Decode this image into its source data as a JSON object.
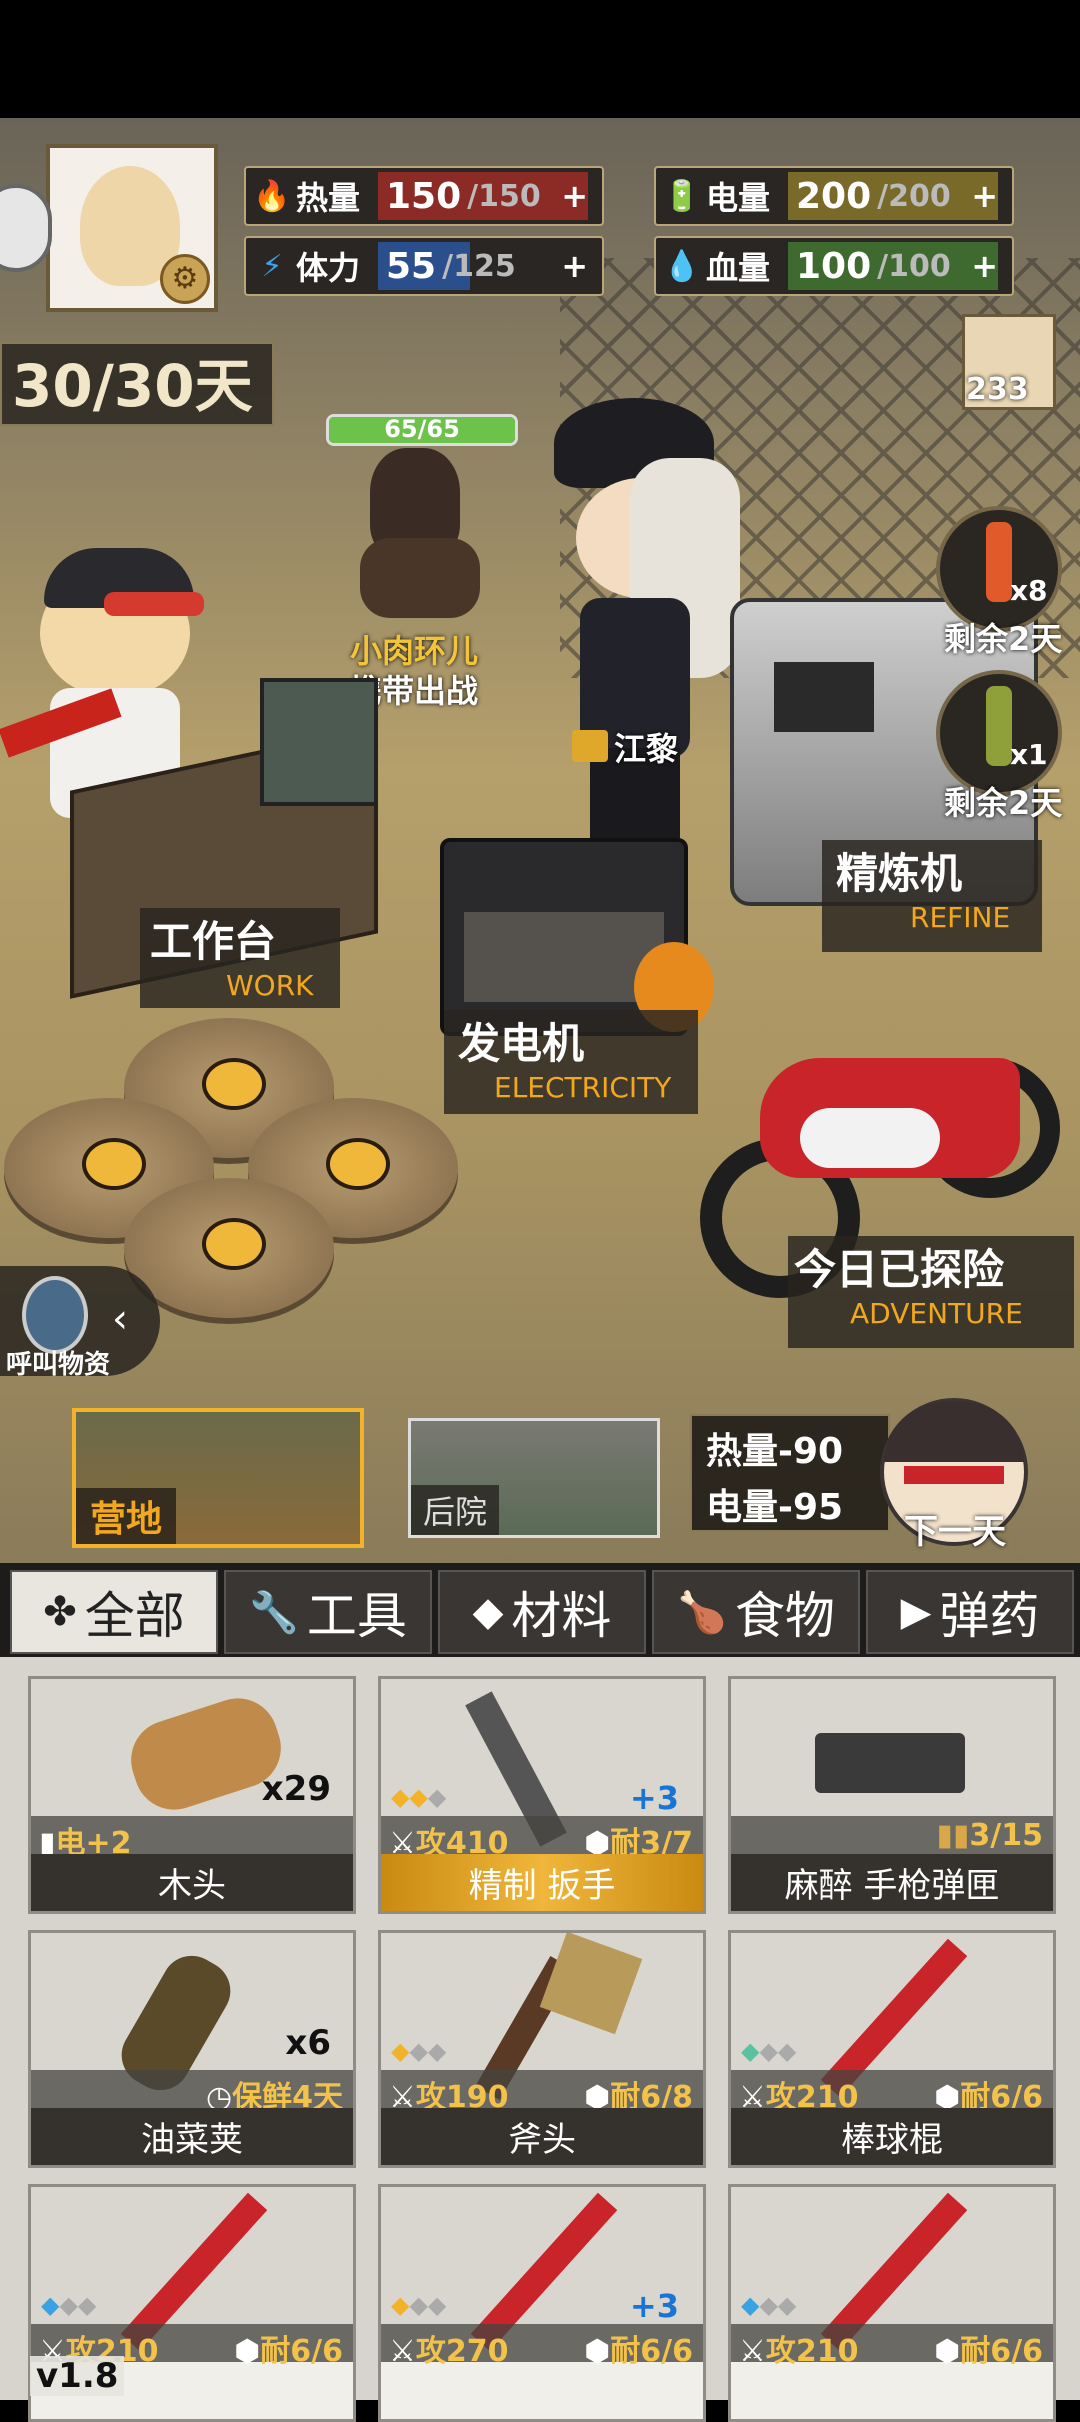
{
  "stats": {
    "heat": {
      "label": "热量",
      "value": "150",
      "max": "/150",
      "plus": "+",
      "color": "#8c2a25",
      "fill": 1.0
    },
    "energy": {
      "label": "体力",
      "value": "55",
      "max": "/125",
      "plus": "+",
      "color": "#2b4f8c",
      "fill": 0.44
    },
    "power": {
      "label": "电量",
      "value": "200",
      "max": "/200",
      "plus": "+",
      "color": "#7a6a2a",
      "fill": 1.0
    },
    "blood": {
      "label": "血量",
      "value": "100",
      "max": "/100",
      "plus": "+",
      "color": "#3f6a2f",
      "fill": 1.0
    }
  },
  "days": "30/30天",
  "paper_count": "233",
  "dog": {
    "hp": "65/65",
    "name": "小肉环儿",
    "action": "携带出战"
  },
  "officer_name": "江黎",
  "potions": [
    {
      "count": "x8",
      "remaining": "剩余2天"
    },
    {
      "count": "x1",
      "remaining": "剩余2天"
    }
  ],
  "stations": {
    "workbench": {
      "cn": "工作台",
      "en": "WORK"
    },
    "generator": {
      "cn": "发电机",
      "en": "ELECTRICITY"
    },
    "refinery": {
      "cn": "精炼机",
      "en": "REFINE"
    },
    "adventure": {
      "cn": "今日已探险",
      "en": "ADVENTURE"
    }
  },
  "call_supplies": "呼叫物资",
  "locations": {
    "camp": "营地",
    "backyard": "后院"
  },
  "next_day": {
    "heat": "热量-90",
    "power": "电量-95",
    "label": "下一天"
  },
  "tabs": [
    "全部",
    "工具",
    "材料",
    "食物",
    "弹药"
  ],
  "items": [
    {
      "name": "木头",
      "count": "x29",
      "stat_left": "电+2"
    },
    {
      "name": "精制 扳手",
      "upgrade": "+3",
      "attack": "攻410",
      "durability": "耐3/7"
    },
    {
      "name": "麻醉 手枪弹匣",
      "ammo": "3/15"
    },
    {
      "name": "油菜荚",
      "count": "x6",
      "stat_right": "保鲜4天"
    },
    {
      "name": "斧头",
      "attack": "攻190",
      "durability": "耐6/8"
    },
    {
      "name": "棒球棍",
      "attack": "攻210",
      "durability": "耐6/6"
    },
    {
      "name": "",
      "attack": "攻210",
      "durability": "耐6/6"
    },
    {
      "name": "",
      "upgrade": "+3",
      "attack": "攻270",
      "durability": "耐6/6"
    },
    {
      "name": "",
      "attack": "攻210",
      "durability": "耐6/6"
    }
  ],
  "version": "v1.8",
  "colors": {
    "accent": "#f2a81e",
    "panel": "#2a2623"
  }
}
